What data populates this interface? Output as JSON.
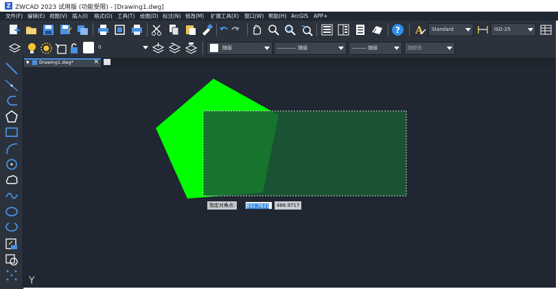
{
  "window": {
    "title": "ZWCAD 2023 试用版 (功能受限) - [Drawing1.dwg]",
    "app_icon": "Z"
  },
  "menu": [
    "文件(F)",
    "编辑(E)",
    "视图(V)",
    "插入(I)",
    "格式(O)",
    "工具(T)",
    "绘图(D)",
    "标注(N)",
    "修改(M)",
    "扩展工具(X)",
    "窗口(W)",
    "帮助(H)",
    "ArcGIS",
    "APP+"
  ],
  "toolbar1": {
    "text_style": "Standard",
    "dim_style": "ISO-25",
    "icons": [
      "new-icon",
      "open-icon",
      "save-icon",
      "saveas-icon",
      "publish-icon",
      "print-icon",
      "plot-preview-icon",
      "plot-icon",
      "cut-icon",
      "copy-icon",
      "paste-icon",
      "match-properties-icon",
      "undo-icon",
      "redo-icon",
      "pan-icon",
      "zoom-realtime-icon",
      "zoom-window-icon",
      "zoom-previous-icon",
      "properties-icon",
      "design-center-icon",
      "tool-palette-icon",
      "markup-icon",
      "help-icon",
      "text-style-icon",
      "dim-style-icon",
      "table-style-icon"
    ]
  },
  "toolbar2": {
    "layer_value": "0",
    "color_value": "随层",
    "linetype_value": "———— 随层",
    "lineweight_value": "——— 随层",
    "plotstyle_value": "随颜色"
  },
  "tab": {
    "label": "Drawing1.dwg*"
  },
  "left_tools": [
    "line-icon",
    "construction-line-icon",
    "polyline-icon",
    "polygon-icon",
    "rectangle-icon",
    "arc-icon",
    "circle-icon",
    "revision-cloud-icon",
    "spline-icon",
    "ellipse-icon",
    "ellipse-arc-icon",
    "insert-block-icon",
    "make-block-icon",
    "point-icon"
  ],
  "command_tooltip": {
    "prompt": "指定对角点:",
    "x_value": "831.7631",
    "y_value": "466.9717"
  },
  "axis_label": "Y",
  "colors": {
    "pentagon": "#00ff00",
    "selection_fill": "#1a5c34",
    "canvas": "#202632"
  }
}
